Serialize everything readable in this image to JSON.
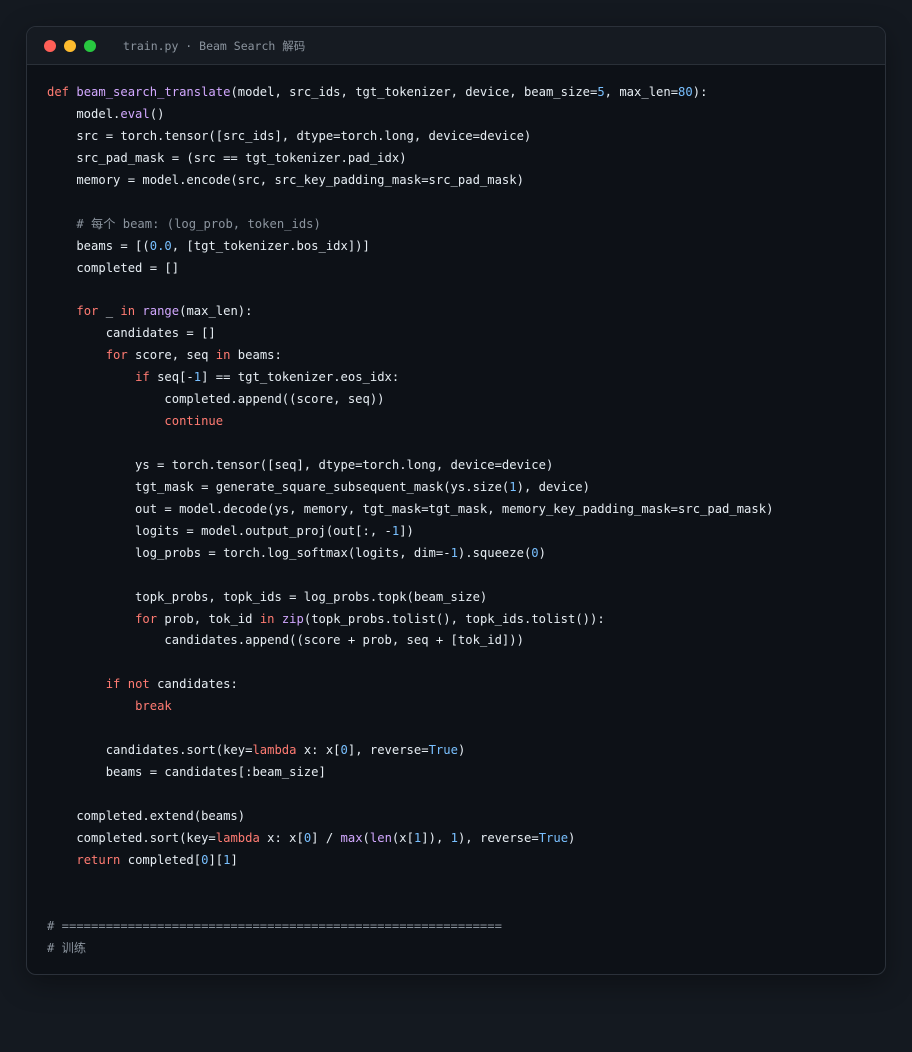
{
  "window": {
    "title": "train.py · Beam Search 解码",
    "controls": [
      {
        "name": "close",
        "color": "#ff5f57"
      },
      {
        "name": "minimize",
        "color": "#febc2e"
      },
      {
        "name": "zoom",
        "color": "#28c840"
      }
    ]
  },
  "colors": {
    "background": "#141920",
    "editor": "#0d1117",
    "keyword": "#ff7b72",
    "function": "#d2a8ff",
    "number": "#79c0ff",
    "comment": "#8b949e",
    "text": "#e6edf3"
  },
  "code": {
    "lines": [
      [
        {
          "t": "kw",
          "v": "def"
        },
        {
          "t": "txt",
          "v": " "
        },
        {
          "t": "fn",
          "v": "beam_search_translate"
        },
        {
          "t": "txt",
          "v": "(model, src_ids, tgt_tokenizer, device, beam_size="
        },
        {
          "t": "num",
          "v": "5"
        },
        {
          "t": "txt",
          "v": ", max_len="
        },
        {
          "t": "num",
          "v": "80"
        },
        {
          "t": "txt",
          "v": "):"
        }
      ],
      [
        {
          "t": "txt",
          "v": "    model."
        },
        {
          "t": "fn",
          "v": "eval"
        },
        {
          "t": "txt",
          "v": "()"
        }
      ],
      [
        {
          "t": "txt",
          "v": "    src = torch.tensor([src_ids], dtype=torch.long, device=device)"
        }
      ],
      [
        {
          "t": "txt",
          "v": "    src_pad_mask = (src == tgt_tokenizer.pad_idx)"
        }
      ],
      [
        {
          "t": "txt",
          "v": "    memory = model.encode(src, src_key_padding_mask=src_pad_mask)"
        }
      ],
      [],
      [
        {
          "t": "cm",
          "v": "    # 每个 beam: (log_prob, token_ids)"
        }
      ],
      [
        {
          "t": "txt",
          "v": "    beams = [("
        },
        {
          "t": "num",
          "v": "0.0"
        },
        {
          "t": "txt",
          "v": ", [tgt_tokenizer.bos_idx])]"
        }
      ],
      [
        {
          "t": "txt",
          "v": "    completed = []"
        }
      ],
      [],
      [
        {
          "t": "txt",
          "v": "    "
        },
        {
          "t": "kw",
          "v": "for"
        },
        {
          "t": "txt",
          "v": " _ "
        },
        {
          "t": "kw",
          "v": "in"
        },
        {
          "t": "txt",
          "v": " "
        },
        {
          "t": "fn",
          "v": "range"
        },
        {
          "t": "txt",
          "v": "(max_len):"
        }
      ],
      [
        {
          "t": "txt",
          "v": "        candidates = []"
        }
      ],
      [
        {
          "t": "txt",
          "v": "        "
        },
        {
          "t": "kw",
          "v": "for"
        },
        {
          "t": "txt",
          "v": " score, seq "
        },
        {
          "t": "kw",
          "v": "in"
        },
        {
          "t": "txt",
          "v": " beams:"
        }
      ],
      [
        {
          "t": "txt",
          "v": "            "
        },
        {
          "t": "kw",
          "v": "if"
        },
        {
          "t": "txt",
          "v": " seq[-"
        },
        {
          "t": "num",
          "v": "1"
        },
        {
          "t": "txt",
          "v": "] == tgt_tokenizer.eos_idx:"
        }
      ],
      [
        {
          "t": "txt",
          "v": "                completed.append((score, seq))"
        }
      ],
      [
        {
          "t": "txt",
          "v": "                "
        },
        {
          "t": "kw",
          "v": "continue"
        }
      ],
      [],
      [
        {
          "t": "txt",
          "v": "            ys = torch.tensor([seq], dtype=torch.long, device=device)"
        }
      ],
      [
        {
          "t": "txt",
          "v": "            tgt_mask = generate_square_subsequent_mask(ys.size("
        },
        {
          "t": "num",
          "v": "1"
        },
        {
          "t": "txt",
          "v": "), device)"
        }
      ],
      [
        {
          "t": "txt",
          "v": "            out = model.decode(ys, memory, tgt_mask=tgt_mask, memory_key_padding_mask=src_pad_mask)"
        }
      ],
      [
        {
          "t": "txt",
          "v": "            logits = model.output_proj(out[:, -"
        },
        {
          "t": "num",
          "v": "1"
        },
        {
          "t": "txt",
          "v": "])"
        }
      ],
      [
        {
          "t": "txt",
          "v": "            log_probs = torch.log_softmax(logits, dim=-"
        },
        {
          "t": "num",
          "v": "1"
        },
        {
          "t": "txt",
          "v": ").squeeze("
        },
        {
          "t": "num",
          "v": "0"
        },
        {
          "t": "txt",
          "v": ")"
        }
      ],
      [],
      [
        {
          "t": "txt",
          "v": "            topk_probs, topk_ids = log_probs.topk(beam_size)"
        }
      ],
      [
        {
          "t": "txt",
          "v": "            "
        },
        {
          "t": "kw",
          "v": "for"
        },
        {
          "t": "txt",
          "v": " prob, tok_id "
        },
        {
          "t": "kw",
          "v": "in"
        },
        {
          "t": "txt",
          "v": " "
        },
        {
          "t": "fn",
          "v": "zip"
        },
        {
          "t": "txt",
          "v": "(topk_probs.tolist(), topk_ids.tolist()):"
        }
      ],
      [
        {
          "t": "txt",
          "v": "                candidates.append((score + prob, seq + [tok_id]))"
        }
      ],
      [],
      [
        {
          "t": "txt",
          "v": "        "
        },
        {
          "t": "kw",
          "v": "if"
        },
        {
          "t": "txt",
          "v": " "
        },
        {
          "t": "kw",
          "v": "not"
        },
        {
          "t": "txt",
          "v": " candidates:"
        }
      ],
      [
        {
          "t": "txt",
          "v": "            "
        },
        {
          "t": "kw",
          "v": "break"
        }
      ],
      [],
      [
        {
          "t": "txt",
          "v": "        candidates.sort(key="
        },
        {
          "t": "kw",
          "v": "lambda"
        },
        {
          "t": "txt",
          "v": " x: x["
        },
        {
          "t": "num",
          "v": "0"
        },
        {
          "t": "txt",
          "v": "], reverse="
        },
        {
          "t": "const",
          "v": "True"
        },
        {
          "t": "txt",
          "v": ")"
        }
      ],
      [
        {
          "t": "txt",
          "v": "        beams = candidates[:beam_size]"
        }
      ],
      [],
      [
        {
          "t": "txt",
          "v": "    completed.extend(beams)"
        }
      ],
      [
        {
          "t": "txt",
          "v": "    completed.sort(key="
        },
        {
          "t": "kw",
          "v": "lambda"
        },
        {
          "t": "txt",
          "v": " x: x["
        },
        {
          "t": "num",
          "v": "0"
        },
        {
          "t": "txt",
          "v": "] / "
        },
        {
          "t": "fn",
          "v": "max"
        },
        {
          "t": "txt",
          "v": "("
        },
        {
          "t": "fn",
          "v": "len"
        },
        {
          "t": "txt",
          "v": "(x["
        },
        {
          "t": "num",
          "v": "1"
        },
        {
          "t": "txt",
          "v": "]), "
        },
        {
          "t": "num",
          "v": "1"
        },
        {
          "t": "txt",
          "v": "), reverse="
        },
        {
          "t": "const",
          "v": "True"
        },
        {
          "t": "txt",
          "v": ")"
        }
      ],
      [
        {
          "t": "txt",
          "v": "    "
        },
        {
          "t": "kw",
          "v": "return"
        },
        {
          "t": "txt",
          "v": " completed["
        },
        {
          "t": "num",
          "v": "0"
        },
        {
          "t": "txt",
          "v": "]["
        },
        {
          "t": "num",
          "v": "1"
        },
        {
          "t": "txt",
          "v": "]"
        }
      ],
      [],
      [],
      [
        {
          "t": "cm",
          "v": "# ============================================================"
        }
      ],
      [
        {
          "t": "cm",
          "v": "# 训练"
        }
      ]
    ]
  }
}
